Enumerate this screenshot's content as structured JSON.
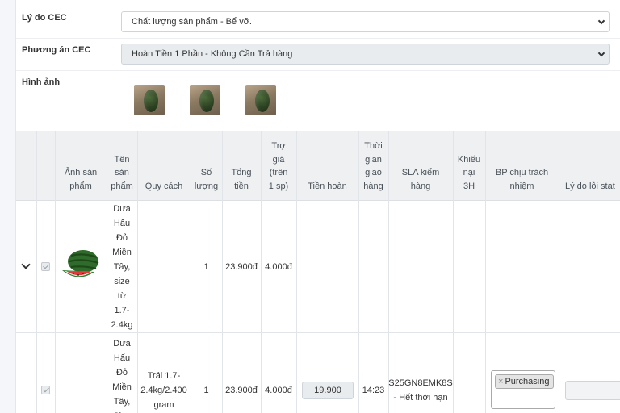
{
  "form": {
    "reason": {
      "label": "Lý do CEC",
      "value": "Chất lượng sản phẩm - Bể vỡ."
    },
    "plan": {
      "label": "Phương án CEC",
      "value": "Hoàn Tiền 1 Phần - Không Cần Trả hàng"
    },
    "images": {
      "label": "Hình ảnh",
      "count": 3
    }
  },
  "table": {
    "headers": [
      "Ảnh sản\nphẩm",
      "Tên\nsản\nphẩm",
      "Quy cách",
      "Số\nlượng",
      "Tổng\ntiền",
      "Trợ\ngiá\n(trên\n1 sp)",
      "Tiền hoàn",
      "Thời\ngian\ngiao\nhàng",
      "SLA kiểm\nhàng",
      "Khiếu\nnại\n3H",
      "BP chịu trách\nnhiệm",
      "Lý do lỗi stat"
    ],
    "rows": [
      {
        "name": "Dưa\nHấu\nĐỏ\nMiền\nTây,\nsize\ntừ\n1.7-\n2.4kg",
        "spec": "",
        "qty": "1",
        "total": "23.900đ",
        "subsidy": "4.000đ",
        "refund": "",
        "delivery": "",
        "sla": "",
        "complaint": "",
        "dept": "",
        "reason": ""
      },
      {
        "name": "Dưa\nHấu\nĐỏ\nMiền\nTây,\nSize",
        "spec": "Trái 1.7-\n2.4kg/2.400\ngram",
        "qty": "1",
        "total": "23.900đ",
        "subsidy": "4.000đ",
        "refund": "19.900",
        "delivery": "14:23",
        "sla": "S25GN8EMK8S\n- Hết thời hạn",
        "complaint": "",
        "dept_tag": "Purchasing",
        "tag_remove": "×"
      }
    ]
  }
}
